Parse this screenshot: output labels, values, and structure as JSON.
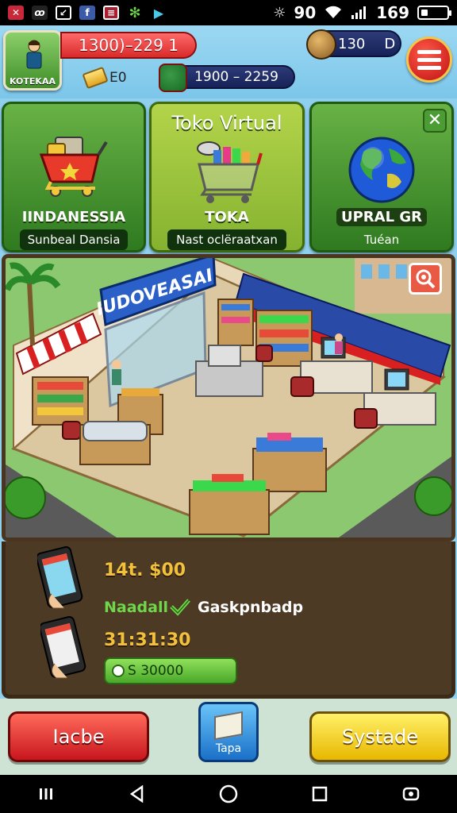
{
  "status_bar": {
    "battery_text": "90",
    "clock_text": "169",
    "icons": [
      "app-icon-1",
      "app-icon-2",
      "app-icon-3",
      "facebook-icon",
      "app-icon-5",
      "settings-icon",
      "play-store-icon"
    ]
  },
  "hud": {
    "player_label": "KOTEKAA",
    "money_text": "1300)–229 1",
    "gold_text": "E0",
    "cash_text": "1900 – 2259",
    "gems_value": "130",
    "gems_suffix": "D"
  },
  "cards": [
    {
      "title": "",
      "name": "IINDANESSIA",
      "subtitle": "Sunbeal Dansia"
    },
    {
      "title": "Toko Virtual",
      "name": "TOKA",
      "subtitle": "Nast oclëraatxan"
    },
    {
      "title": "",
      "name": "UPRAL GR",
      "subtitle": "Tuéan"
    }
  ],
  "scene": {
    "store_sign": "IUDOVEASAI"
  },
  "info": {
    "price": "14t. $00",
    "owner_green": "Naadall",
    "owner_white": "Gaskpnbadp",
    "time": "31:31:30",
    "amount": "S 30000"
  },
  "buttons": {
    "left": "Iacbe",
    "center": "Tapa",
    "right": "Systade"
  },
  "colors": {
    "accent_red": "#d82a2a",
    "accent_green": "#4aa82a",
    "accent_yellow": "#e8b800",
    "panel_brown": "#4d3a24"
  }
}
